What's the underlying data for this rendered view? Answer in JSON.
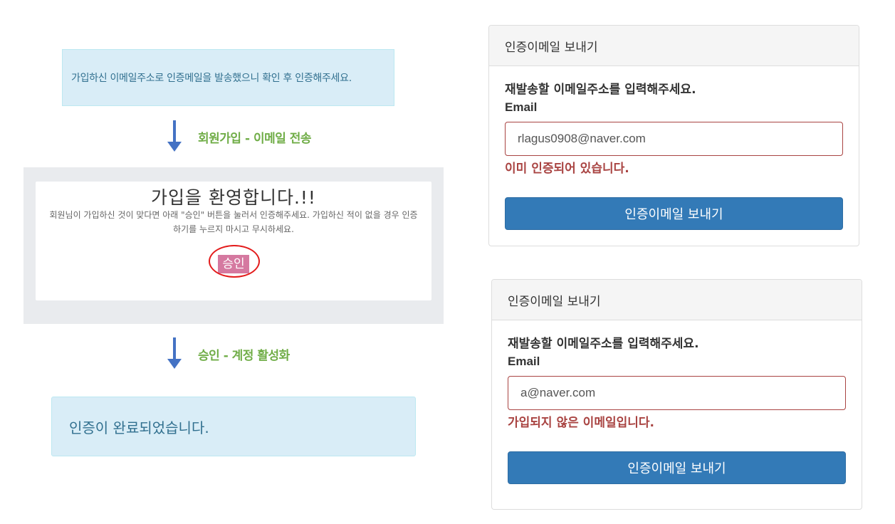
{
  "left": {
    "sent_notice": "가입하신 이메일주소로 인증메일을 발송했으니 확인 후 인증해주세요.",
    "step1_label": "회원가입 - 이메일 전송",
    "email_preview": {
      "title": "가입을 환영합니다.!!",
      "body": "회원님이 가입하신 것이 맞다면 아래 \"승인\" 버튼을 눌러서 인증해주세요. 가입하신 적이 없을 경우 인증하기를 누르지 마시고 무시하세요.",
      "approve_label": "승인"
    },
    "step2_label": "승인 - 계정 활성화",
    "done_notice": "인증이 완료되었습니다."
  },
  "panels": [
    {
      "heading": "인증이메일 보내기",
      "prompt": "재발송할 이메일주소를 입력해주세요.",
      "field_label": "Email",
      "email_value": "rlagus0908@naver.com",
      "error": "이미 인증되어 있습니다.",
      "button": "인증이메일 보내기"
    },
    {
      "heading": "인증이메일 보내기",
      "prompt": "재발송할 이메일주소를 입력해주세요.",
      "field_label": "Email",
      "email_value": "a@naver.com",
      "error": "가입되지 않은 이메일입니다.",
      "button": "인증이메일 보내기"
    }
  ],
  "colors": {
    "info_bg": "#d9edf7",
    "info_text": "#31708f",
    "step_green": "#70ad47",
    "arrow_blue": "#4472c4",
    "error_red": "#a94442",
    "primary_blue": "#337ab7",
    "approve_pink": "#d579a0"
  }
}
